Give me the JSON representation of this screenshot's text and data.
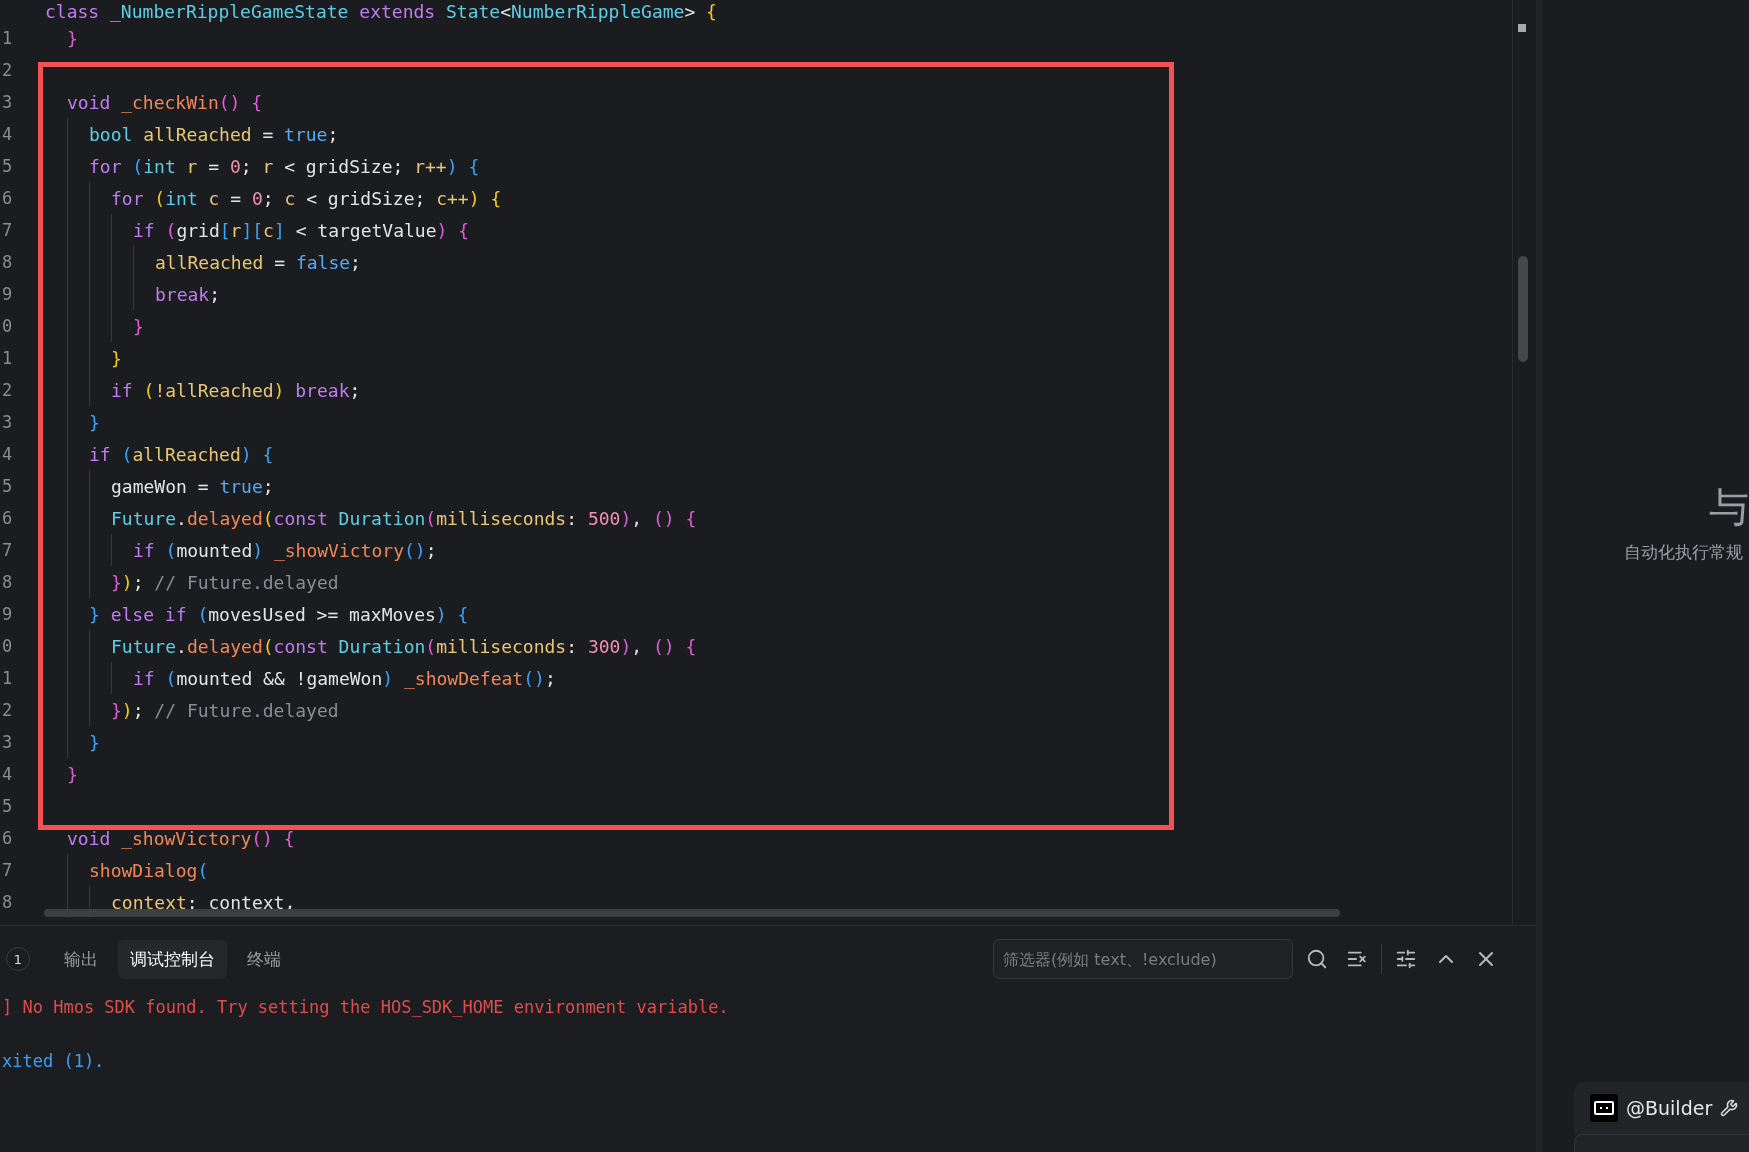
{
  "editor": {
    "lines": [
      {
        "segments": [
          {
            "text": "class ",
            "color": "#c07cf2"
          },
          {
            "text": "_NumberRippleGameState",
            "color": "#5ccfe6"
          },
          {
            "text": " extends ",
            "color": "#c07cf2"
          },
          {
            "text": "State",
            "color": "#5ccfe6"
          },
          {
            "text": "<",
            "color": "#e4e4e4"
          },
          {
            "text": "NumberRippleGame",
            "color": "#5ccfe6"
          },
          {
            "text": "> ",
            "color": "#e4e4e4"
          },
          {
            "text": "{",
            "color": "#f2cc2c"
          }
        ],
        "children": [
          {
            "num": "1",
            "segments": [
              {
                "text": "}",
                "color": "#dd5fd6"
              }
            ]
          },
          {
            "num": "2"
          },
          {
            "num": "3",
            "segments": [
              {
                "text": "void ",
                "color": "#c07cf2"
              },
              {
                "text": "_checkWin",
                "color": "#f0885a"
              },
              {
                "text": "() {",
                "color": "#dd5fd6"
              }
            ],
            "children": [
              {
                "num": "4",
                "segments": [
                  {
                    "text": "bool",
                    "color": "#5ccfe6"
                  },
                  {
                    "text": " allReached",
                    "color": "#e8c877"
                  },
                  {
                    "text": " = ",
                    "color": "#e4e4e4"
                  },
                  {
                    "text": "true",
                    "color": "#5aa9f5"
                  },
                  {
                    "text": ";",
                    "color": "#e4e4e4"
                  }
                ]
              },
              {
                "num": "5",
                "segments": [
                  {
                    "text": "for",
                    "color": "#c07cf2"
                  },
                  {
                    "text": " (",
                    "color": "#3ea2f7"
                  },
                  {
                    "text": "int",
                    "color": "#5ccfe6"
                  },
                  {
                    "text": " r",
                    "color": "#e8c877"
                  },
                  {
                    "text": " = ",
                    "color": "#e4e4e4"
                  },
                  {
                    "text": "0",
                    "color": "#f58fb0"
                  },
                  {
                    "text": "; ",
                    "color": "#e4e4e4"
                  },
                  {
                    "text": "r",
                    "color": "#e8c877"
                  },
                  {
                    "text": " < gridSize; ",
                    "color": "#e4e4e4"
                  },
                  {
                    "text": "r++",
                    "color": "#e8c877"
                  },
                  {
                    "text": ") {",
                    "color": "#3ea2f7"
                  }
                ],
                "children": [
                  {
                    "num": "6",
                    "segments": [
                      {
                        "text": "for",
                        "color": "#c07cf2"
                      },
                      {
                        "text": " (",
                        "color": "#f2cc2c"
                      },
                      {
                        "text": "int",
                        "color": "#5ccfe6"
                      },
                      {
                        "text": " c",
                        "color": "#e8c877"
                      },
                      {
                        "text": " = ",
                        "color": "#e4e4e4"
                      },
                      {
                        "text": "0",
                        "color": "#f58fb0"
                      },
                      {
                        "text": "; ",
                        "color": "#e4e4e4"
                      },
                      {
                        "text": "c",
                        "color": "#e8c877"
                      },
                      {
                        "text": " < gridSize; ",
                        "color": "#e4e4e4"
                      },
                      {
                        "text": "c++",
                        "color": "#e8c877"
                      },
                      {
                        "text": ") {",
                        "color": "#f2cc2c"
                      }
                    ],
                    "children": [
                      {
                        "num": "7",
                        "segments": [
                          {
                            "text": "if",
                            "color": "#c07cf2"
                          },
                          {
                            "text": " (",
                            "color": "#dd5fd6"
                          },
                          {
                            "text": "grid",
                            "color": "#e4e4e4"
                          },
                          {
                            "text": "[",
                            "color": "#3ea2f7"
                          },
                          {
                            "text": "r",
                            "color": "#e8c877"
                          },
                          {
                            "text": "][",
                            "color": "#3ea2f7"
                          },
                          {
                            "text": "c",
                            "color": "#e8c877"
                          },
                          {
                            "text": "]",
                            "color": "#3ea2f7"
                          },
                          {
                            "text": " < targetValue",
                            "color": "#e4e4e4"
                          },
                          {
                            "text": ") {",
                            "color": "#dd5fd6"
                          }
                        ],
                        "children": [
                          {
                            "num": "8",
                            "segments": [
                              {
                                "text": "allReached",
                                "color": "#e8c877"
                              },
                              {
                                "text": " = ",
                                "color": "#e4e4e4"
                              },
                              {
                                "text": "false",
                                "color": "#5aa9f5"
                              },
                              {
                                "text": ";",
                                "color": "#e4e4e4"
                              }
                            ]
                          },
                          {
                            "num": "9",
                            "segments": [
                              {
                                "text": "break",
                                "color": "#c07cf2"
                              },
                              {
                                "text": ";",
                                "color": "#e4e4e4"
                              }
                            ]
                          }
                        ]
                      },
                      {
                        "num": "0",
                        "segments": [
                          {
                            "text": "}",
                            "color": "#dd5fd6"
                          }
                        ]
                      }
                    ]
                  },
                  {
                    "num": "1",
                    "segments": [
                      {
                        "text": "}",
                        "color": "#f2cc2c"
                      }
                    ]
                  },
                  {
                    "num": "2",
                    "segments": [
                      {
                        "text": "if",
                        "color": "#c07cf2"
                      },
                      {
                        "text": " (",
                        "color": "#f2cc2c"
                      },
                      {
                        "text": "!allReached",
                        "color": "#e8c877"
                      },
                      {
                        "text": ") ",
                        "color": "#f2cc2c"
                      },
                      {
                        "text": "break",
                        "color": "#c07cf2"
                      },
                      {
                        "text": ";",
                        "color": "#e4e4e4"
                      }
                    ]
                  }
                ]
              },
              {
                "num": "3",
                "segments": [
                  {
                    "text": "}",
                    "color": "#3ea2f7"
                  }
                ]
              },
              {
                "num": "4",
                "segments": [
                  {
                    "text": "if",
                    "color": "#c07cf2"
                  },
                  {
                    "text": " (",
                    "color": "#3ea2f7"
                  },
                  {
                    "text": "allReached",
                    "color": "#e8c877"
                  },
                  {
                    "text": ") {",
                    "color": "#3ea2f7"
                  }
                ],
                "children": [
                  {
                    "num": "5",
                    "segments": [
                      {
                        "text": "gameWon = ",
                        "color": "#e4e4e4"
                      },
                      {
                        "text": "true",
                        "color": "#5aa9f5"
                      },
                      {
                        "text": ";",
                        "color": "#e4e4e4"
                      }
                    ]
                  },
                  {
                    "num": "6",
                    "segments": [
                      {
                        "text": "Future",
                        "color": "#5ccfe6"
                      },
                      {
                        "text": "."
                      },
                      {
                        "text": "delayed",
                        "color": "#f0885a"
                      },
                      {
                        "text": "(",
                        "color": "#f2cc2c"
                      },
                      {
                        "text": "const ",
                        "color": "#c07cf2"
                      },
                      {
                        "text": "Duration",
                        "color": "#5ccfe6"
                      },
                      {
                        "text": "(",
                        "color": "#dd5fd6"
                      },
                      {
                        "text": "milliseconds",
                        "color": "#e8c877"
                      },
                      {
                        "text": ": ",
                        "color": "#e4e4e4"
                      },
                      {
                        "text": "500",
                        "color": "#f58fb0"
                      },
                      {
                        "text": ")",
                        "color": "#dd5fd6"
                      },
                      {
                        "text": ", ",
                        "color": "#e4e4e4"
                      },
                      {
                        "text": "() {",
                        "color": "#dd5fd6"
                      }
                    ],
                    "children": [
                      {
                        "num": "7",
                        "segments": [
                          {
                            "text": "if",
                            "color": "#c07cf2"
                          },
                          {
                            "text": " (",
                            "color": "#3ea2f7"
                          },
                          {
                            "text": "mounted",
                            "color": "#e4e4e4"
                          },
                          {
                            "text": ") ",
                            "color": "#3ea2f7"
                          },
                          {
                            "text": "_showVictory",
                            "color": "#f0885a"
                          },
                          {
                            "text": "()",
                            "color": "#3ea2f7"
                          },
                          {
                            "text": ";",
                            "color": "#e4e4e4"
                          }
                        ]
                      }
                    ]
                  },
                  {
                    "num": "8",
                    "segments": [
                      {
                        "text": "}",
                        "color": "#dd5fd6"
                      },
                      {
                        "text": ")",
                        "color": "#f2cc2c"
                      },
                      {
                        "text": ";",
                        "color": "#e4e4e4"
                      },
                      {
                        "text": " // Future.delayed",
                        "color": "#8b8d92"
                      }
                    ]
                  }
                ]
              },
              {
                "num": "9",
                "segments": [
                  {
                    "text": "}",
                    "color": "#3ea2f7"
                  },
                  {
                    "text": " else if",
                    "color": "#c07cf2"
                  },
                  {
                    "text": " (",
                    "color": "#3ea2f7"
                  },
                  {
                    "text": "movesUsed >= maxMoves",
                    "color": "#e4e4e4"
                  },
                  {
                    "text": ") {",
                    "color": "#3ea2f7"
                  }
                ],
                "children": [
                  {
                    "num": "0",
                    "segments": [
                      {
                        "text": "Future",
                        "color": "#5ccfe6"
                      },
                      {
                        "text": "."
                      },
                      {
                        "text": "delayed",
                        "color": "#f0885a"
                      },
                      {
                        "text": "(",
                        "color": "#f2cc2c"
                      },
                      {
                        "text": "const ",
                        "color": "#c07cf2"
                      },
                      {
                        "text": "Duration",
                        "color": "#5ccfe6"
                      },
                      {
                        "text": "(",
                        "color": "#dd5fd6"
                      },
                      {
                        "text": "milliseconds",
                        "color": "#e8c877"
                      },
                      {
                        "text": ": ",
                        "color": "#e4e4e4"
                      },
                      {
                        "text": "300",
                        "color": "#f58fb0"
                      },
                      {
                        "text": ")",
                        "color": "#dd5fd6"
                      },
                      {
                        "text": ", ",
                        "color": "#e4e4e4"
                      },
                      {
                        "text": "() {",
                        "color": "#dd5fd6"
                      }
                    ],
                    "children": [
                      {
                        "num": "1",
                        "segments": [
                          {
                            "text": "if",
                            "color": "#c07cf2"
                          },
                          {
                            "text": " (",
                            "color": "#3ea2f7"
                          },
                          {
                            "text": "mounted && !gameWon",
                            "color": "#e4e4e4"
                          },
                          {
                            "text": ") ",
                            "color": "#3ea2f7"
                          },
                          {
                            "text": "_showDefeat",
                            "color": "#f0885a"
                          },
                          {
                            "text": "()",
                            "color": "#3ea2f7"
                          },
                          {
                            "text": ";",
                            "color": "#e4e4e4"
                          }
                        ]
                      }
                    ]
                  },
                  {
                    "num": "2",
                    "segments": [
                      {
                        "text": "}",
                        "color": "#dd5fd6"
                      },
                      {
                        "text": ")",
                        "color": "#f2cc2c"
                      },
                      {
                        "text": ";",
                        "color": "#e4e4e4"
                      },
                      {
                        "text": " // Future.delayed",
                        "color": "#8b8d92"
                      }
                    ]
                  }
                ]
              },
              {
                "num": "3",
                "segments": [
                  {
                    "text": "}",
                    "color": "#3ea2f7"
                  }
                ]
              }
            ]
          },
          {
            "num": "4",
            "segments": [
              {
                "text": "}",
                "color": "#dd5fd6"
              }
            ]
          },
          {
            "num": "5"
          },
          {
            "num": "6",
            "segments": [
              {
                "text": "void ",
                "color": "#c07cf2"
              },
              {
                "text": "_showVictory",
                "color": "#f0885a"
              },
              {
                "text": "() {",
                "color": "#dd5fd6"
              }
            ],
            "children": [
              {
                "num": "7",
                "segments": [
                  {
                    "text": "showDialog",
                    "color": "#f0885a"
                  },
                  {
                    "text": "(",
                    "color": "#3ea2f7"
                  }
                ],
                "children": [
                  {
                    "num": "8",
                    "segments": [
                      {
                        "text": "context",
                        "color": "#e8c877"
                      },
                      {
                        "text": ": context,",
                        "color": "#e4e4e4"
                      }
                    ]
                  }
                ]
              }
            ]
          }
        ]
      }
    ]
  },
  "panel": {
    "badge": "1",
    "tabs": [
      {
        "label": "输出",
        "selected": false
      },
      {
        "label": "调试控制台",
        "selected": true
      },
      {
        "label": "终端",
        "selected": false
      }
    ],
    "filter": {
      "placeholder": "筛选器(例如 text、!exclude)"
    },
    "output": [
      {
        "text": "] No Hmos SDK found. Try setting the HOS_SDK_HOME environment variable.",
        "kind": "error"
      },
      {
        "text": "xited (1).",
        "kind": "info"
      }
    ]
  },
  "side": {
    "heading": "与",
    "subtitle": "自动化执行常规",
    "agent": "@Builder"
  }
}
